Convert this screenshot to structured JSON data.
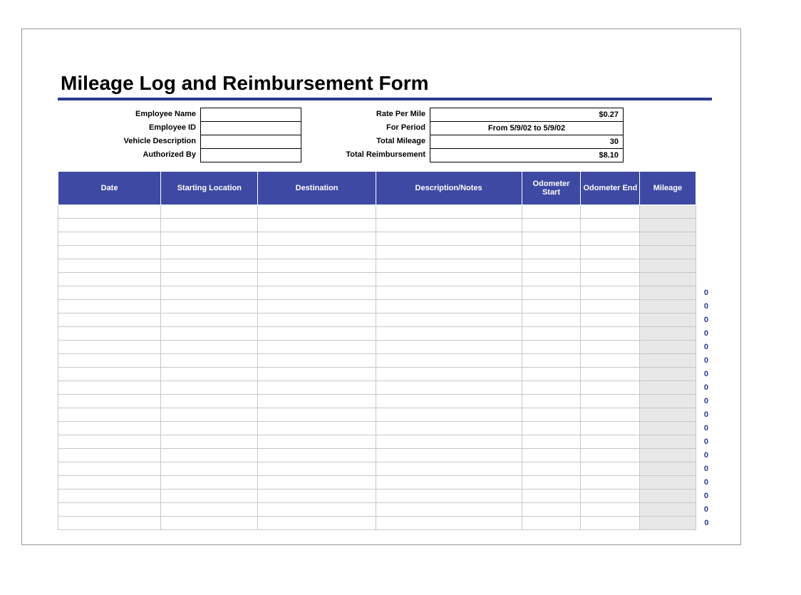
{
  "title": "Mileage Log and Reimbursement Form",
  "left_fields": {
    "employee_name_label": "Employee Name",
    "employee_name_value": "",
    "employee_id_label": "Employee ID",
    "employee_id_value": "",
    "vehicle_desc_label": "Vehicle Description",
    "vehicle_desc_value": "",
    "authorized_by_label": "Authorized By",
    "authorized_by_value": ""
  },
  "right_fields": {
    "rate_label": "Rate Per Mile",
    "rate_value": "$0.27",
    "period_label": "For Period",
    "period_value": "From 5/9/02 to 5/9/02",
    "total_mileage_label": "Total Mileage",
    "total_mileage_value": "30",
    "total_reimb_label": "Total Reimbursement",
    "total_reimb_value": "$8.10"
  },
  "columns": {
    "date": "Date",
    "starting_location": "Starting Location",
    "destination": "Destination",
    "description": "Description/Notes",
    "odometer_start": "Odometer Start",
    "odometer_end": "Odometer End",
    "mileage": "Mileage"
  },
  "rows": [
    {
      "date": "",
      "start": "",
      "dest": "",
      "desc": "",
      "ostart": "",
      "oend": "",
      "mileage": "",
      "zero": ""
    },
    {
      "date": "",
      "start": "",
      "dest": "",
      "desc": "",
      "ostart": "",
      "oend": "",
      "mileage": "",
      "zero": ""
    },
    {
      "date": "",
      "start": "",
      "dest": "",
      "desc": "",
      "ostart": "",
      "oend": "",
      "mileage": "",
      "zero": ""
    },
    {
      "date": "",
      "start": "",
      "dest": "",
      "desc": "",
      "ostart": "",
      "oend": "",
      "mileage": "",
      "zero": ""
    },
    {
      "date": "",
      "start": "",
      "dest": "",
      "desc": "",
      "ostart": "",
      "oend": "",
      "mileage": "",
      "zero": ""
    },
    {
      "date": "",
      "start": "",
      "dest": "",
      "desc": "",
      "ostart": "",
      "oend": "",
      "mileage": "",
      "zero": ""
    },
    {
      "date": "",
      "start": "",
      "dest": "",
      "desc": "",
      "ostart": "",
      "oend": "",
      "mileage": "",
      "zero": "0"
    },
    {
      "date": "",
      "start": "",
      "dest": "",
      "desc": "",
      "ostart": "",
      "oend": "",
      "mileage": "",
      "zero": "0"
    },
    {
      "date": "",
      "start": "",
      "dest": "",
      "desc": "",
      "ostart": "",
      "oend": "",
      "mileage": "",
      "zero": "0"
    },
    {
      "date": "",
      "start": "",
      "dest": "",
      "desc": "",
      "ostart": "",
      "oend": "",
      "mileage": "",
      "zero": "0"
    },
    {
      "date": "",
      "start": "",
      "dest": "",
      "desc": "",
      "ostart": "",
      "oend": "",
      "mileage": "",
      "zero": "0"
    },
    {
      "date": "",
      "start": "",
      "dest": "",
      "desc": "",
      "ostart": "",
      "oend": "",
      "mileage": "",
      "zero": "0"
    },
    {
      "date": "",
      "start": "",
      "dest": "",
      "desc": "",
      "ostart": "",
      "oend": "",
      "mileage": "",
      "zero": "0"
    },
    {
      "date": "",
      "start": "",
      "dest": "",
      "desc": "",
      "ostart": "",
      "oend": "",
      "mileage": "",
      "zero": "0"
    },
    {
      "date": "",
      "start": "",
      "dest": "",
      "desc": "",
      "ostart": "",
      "oend": "",
      "mileage": "",
      "zero": "0"
    },
    {
      "date": "",
      "start": "",
      "dest": "",
      "desc": "",
      "ostart": "",
      "oend": "",
      "mileage": "",
      "zero": "0"
    },
    {
      "date": "",
      "start": "",
      "dest": "",
      "desc": "",
      "ostart": "",
      "oend": "",
      "mileage": "",
      "zero": "0"
    },
    {
      "date": "",
      "start": "",
      "dest": "",
      "desc": "",
      "ostart": "",
      "oend": "",
      "mileage": "",
      "zero": "0"
    },
    {
      "date": "",
      "start": "",
      "dest": "",
      "desc": "",
      "ostart": "",
      "oend": "",
      "mileage": "",
      "zero": "0"
    },
    {
      "date": "",
      "start": "",
      "dest": "",
      "desc": "",
      "ostart": "",
      "oend": "",
      "mileage": "",
      "zero": "0"
    },
    {
      "date": "",
      "start": "",
      "dest": "",
      "desc": "",
      "ostart": "",
      "oend": "",
      "mileage": "",
      "zero": "0"
    },
    {
      "date": "",
      "start": "",
      "dest": "",
      "desc": "",
      "ostart": "",
      "oend": "",
      "mileage": "",
      "zero": "0"
    },
    {
      "date": "",
      "start": "",
      "dest": "",
      "desc": "",
      "ostart": "",
      "oend": "",
      "mileage": "",
      "zero": "0"
    },
    {
      "date": "",
      "start": "",
      "dest": "",
      "desc": "",
      "ostart": "",
      "oend": "",
      "mileage": "",
      "zero": "0"
    }
  ]
}
